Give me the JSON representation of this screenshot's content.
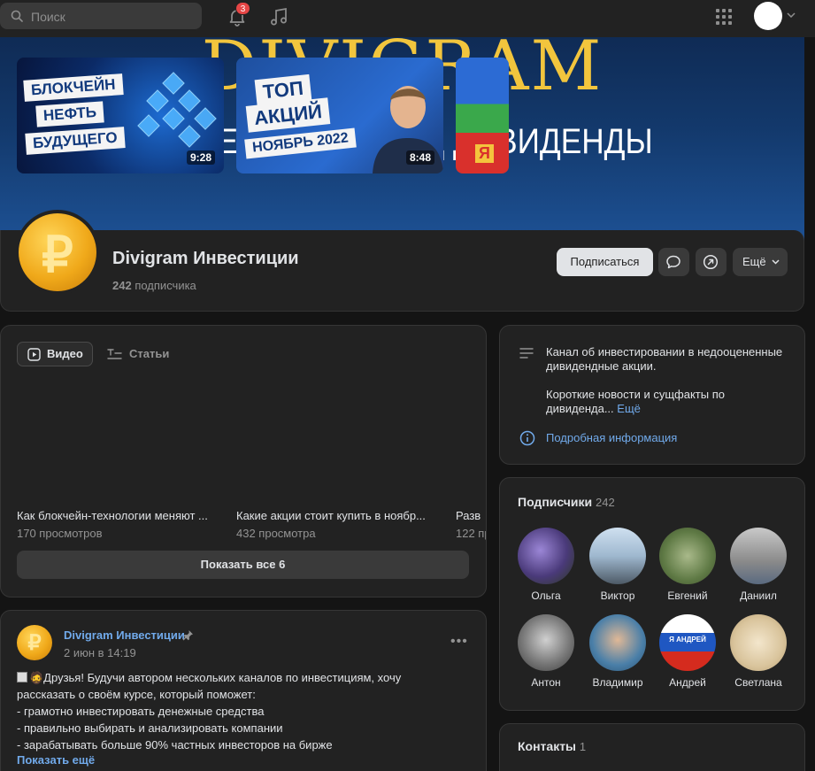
{
  "topbar": {
    "search_placeholder": "Поиск",
    "notifications_count": "3"
  },
  "cover": {
    "title": "DIVIGRAM",
    "subtitle": "ИНВЕСТИЦИИ ПОД ДИВИДЕНДЫ"
  },
  "group": {
    "name": "Divigram Инвестиции",
    "subscribers_count": "242",
    "subscribers_word": "подписчика",
    "avatar_symbol": "₽"
  },
  "actions": {
    "subscribe": "Подписаться",
    "more": "Ещё"
  },
  "tabs": {
    "video": "Видео",
    "articles": "Статьи"
  },
  "videos": [
    {
      "title": "Как блокчейн-технологии меняют ...",
      "views": "170 просмотров",
      "duration": "9:28",
      "thumb_lines": [
        "БЛОКЧЕЙН",
        "НЕФТЬ",
        "БУДУЩЕГО"
      ]
    },
    {
      "title": "Какие акции стоит купить в ноябр...",
      "views": "432 просмотра",
      "duration": "8:48",
      "thumb_lines": [
        "ТОП",
        "АКЦИЙ",
        "НОЯБРЬ 2022"
      ]
    },
    {
      "title": "Разв",
      "views": "122 пр",
      "thumb_lines": [
        "Я"
      ]
    }
  ],
  "show_all": "Показать все 6",
  "post": {
    "author": "Divigram Инвестиции",
    "date": "2 июн в 14:19",
    "avatar_symbol": "₽",
    "lines": [
      "🧔Друзья! Будучи автором нескольких каналов по инвестициям, хочу",
      "рассказать о своём курсе, который поможет:",
      "- грамотно инвестировать денежные средства",
      "- правильно выбирать и анализировать компании",
      "- зарабатывать больше 90% частных инвесторов на бирже"
    ],
    "show_more": "Показать ещё"
  },
  "about": {
    "line1": "Канал об инвестировании в недооцененные дивидендные акции.",
    "line2": "Короткие новости и сущфакты по дивиденда...",
    "more_link": "Ещё",
    "details_link": "Подробная информация"
  },
  "subscribers": {
    "title": "Подписчики",
    "count": "242",
    "people": [
      {
        "name": "Ольга",
        "color": "#5b4a8a"
      },
      {
        "name": "Виктор",
        "color": "#8aa7c4"
      },
      {
        "name": "Евгений",
        "color": "#6f8a5a"
      },
      {
        "name": "Даниил",
        "color": "#9b9b9b"
      },
      {
        "name": "Антон",
        "color": "#6a6a6a"
      },
      {
        "name": "Владимир",
        "color": "#4a7fa8"
      },
      {
        "name": "Андрей",
        "color": "#ffffff",
        "flag_text": "Я АНДРЕЙ"
      },
      {
        "name": "Светлана",
        "color": "#e8dcc4"
      }
    ]
  },
  "contacts": {
    "title": "Контакты",
    "count": "1"
  },
  "colors": {
    "link": "#71aaeb",
    "card": "#222222",
    "background": "#141414",
    "gold": "#f2c53d",
    "badge": "#e64646"
  }
}
